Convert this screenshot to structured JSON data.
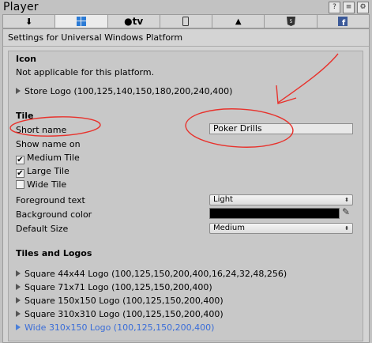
{
  "window": {
    "title": "Player"
  },
  "tabs": [
    {
      "label": "",
      "icon": "download-icon"
    },
    {
      "label": "",
      "icon": "windows-icon",
      "active": true
    },
    {
      "label": "tv",
      "icon": "apple-icon"
    },
    {
      "label": "",
      "icon": "phone-icon"
    },
    {
      "label": "",
      "icon": "android-icon"
    },
    {
      "label": "",
      "icon": "html5-icon"
    },
    {
      "label": "",
      "icon": "facebook-icon"
    }
  ],
  "settings_title": "Settings for Universal Windows Platform",
  "icon_section": {
    "heading": "Icon",
    "note": "Not applicable for this platform.",
    "store_logo": "Store Logo (100,125,140,150,180,200,240,400)"
  },
  "tile": {
    "heading": "Tile",
    "short_name_label": "Short name",
    "short_name_value": "Poker Drills",
    "show_name_on": "Show name on",
    "medium_tile": "Medium Tile",
    "large_tile": "Large Tile",
    "wide_tile": "Wide Tile",
    "foreground_label": "Foreground text",
    "foreground_value": "Light",
    "background_label": "Background color",
    "background_color": "#000000",
    "default_size_label": "Default Size",
    "default_size_value": "Medium"
  },
  "tiles_logos": {
    "heading": "Tiles and Logos",
    "items": [
      "Square 44x44 Logo (100,125,150,200,400,16,24,32,48,256)",
      "Square 71x71 Logo (100,125,150,200,400)",
      "Square 150x150 Logo (100,125,150,200,400)",
      "Square 310x310 Logo (100,125,150,200,400)",
      "Wide 310x150 Logo (100,125,150,200,400)"
    ]
  }
}
